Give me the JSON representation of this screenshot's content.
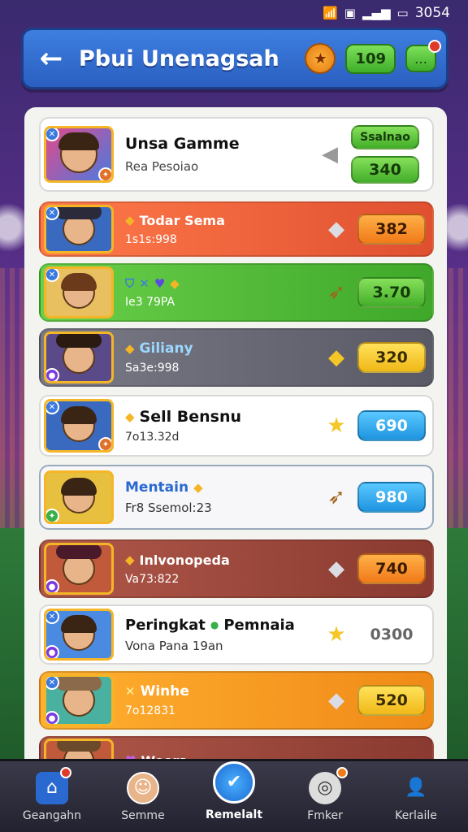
{
  "status_bar": {
    "time": "3054",
    "wifi_icon": "wifi-icon",
    "signal_icon": "signal-icon",
    "battery_icon": "battery-icon"
  },
  "header": {
    "title": "Pbui Unenagsah",
    "back_icon": "arrow-left-icon",
    "coin_value": "109",
    "badge_icon": "trophy-badge-icon",
    "chat_icon": "chat-icon"
  },
  "rows": [
    {
      "name": "Unsa Gamme",
      "sub": "Rea Pesoiao",
      "tag": "Ssalnao",
      "score": "340",
      "style": "white"
    },
    {
      "name": "Todar Sema",
      "sub": "1s1s:998",
      "score": "382",
      "style": "orange"
    },
    {
      "name": "",
      "sub": "Ie3 79PA",
      "score": "3.70",
      "style": "green"
    },
    {
      "name": "Giliany",
      "sub": "Sa3e:998",
      "score": "320",
      "style": "gray"
    },
    {
      "name": "Sell Bensnu",
      "sub": "7o13.32d",
      "score": "690",
      "style": "white"
    },
    {
      "name": "Mentain",
      "sub": "Fr8 Ssemol:23",
      "score": "980",
      "style": "white"
    },
    {
      "name": "Inlvonopeda",
      "sub": "Va73:822",
      "score": "740",
      "style": "brown"
    },
    {
      "name": "Peringkat",
      "name2": "Pemnaia",
      "sub": "Vona Pana 19an",
      "score": "0300",
      "style": "white"
    },
    {
      "name": "Winhe",
      "sub": "7o12831",
      "score": "520",
      "style": "amber"
    },
    {
      "name": "Weors",
      "sub": "",
      "score": "",
      "style": "brown"
    }
  ],
  "nav": [
    {
      "label": "Geangahn",
      "icon": "home-icon"
    },
    {
      "label": "Semme",
      "icon": "profile-icon"
    },
    {
      "label": "Remelalt",
      "icon": "check-icon"
    },
    {
      "label": "Fmker",
      "icon": "target-icon"
    },
    {
      "label": "Kerlaile",
      "icon": "user-icon"
    }
  ]
}
